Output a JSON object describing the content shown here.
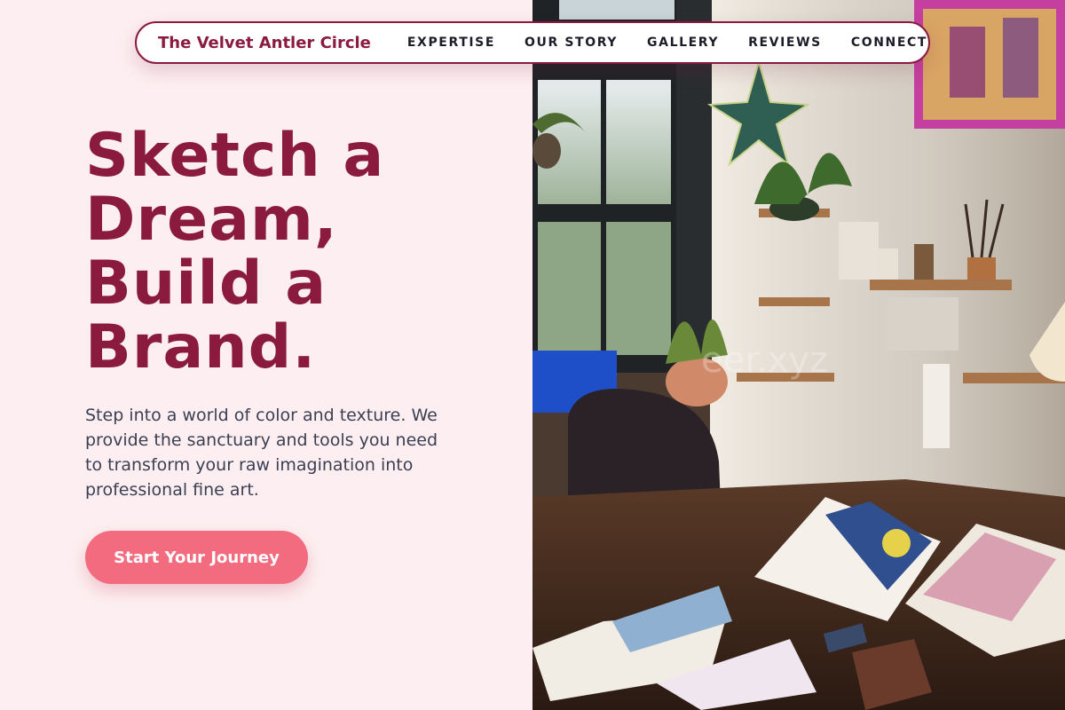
{
  "nav": {
    "brand": "The Velvet Antler Circle",
    "links": [
      "EXPERTISE",
      "OUR STORY",
      "GALLERY",
      "REVIEWS",
      "CONNECT"
    ]
  },
  "hero": {
    "title_lines": [
      "Sketch a",
      "Dream,",
      "Build a",
      "Brand."
    ],
    "subtitle": "Step into a world of color and texture. We provide the sanctuary and tools you need to transform your raw imagination into professional fine art.",
    "cta_label": "Start Your Journey"
  },
  "photo": {
    "description_icon": "art-studio-photo",
    "watermark": "eer.xyz"
  },
  "colors": {
    "brand": "#8b1a3f",
    "background": "#fdeff1",
    "cta": "#f26b7e",
    "body_text": "#3b3f52"
  }
}
